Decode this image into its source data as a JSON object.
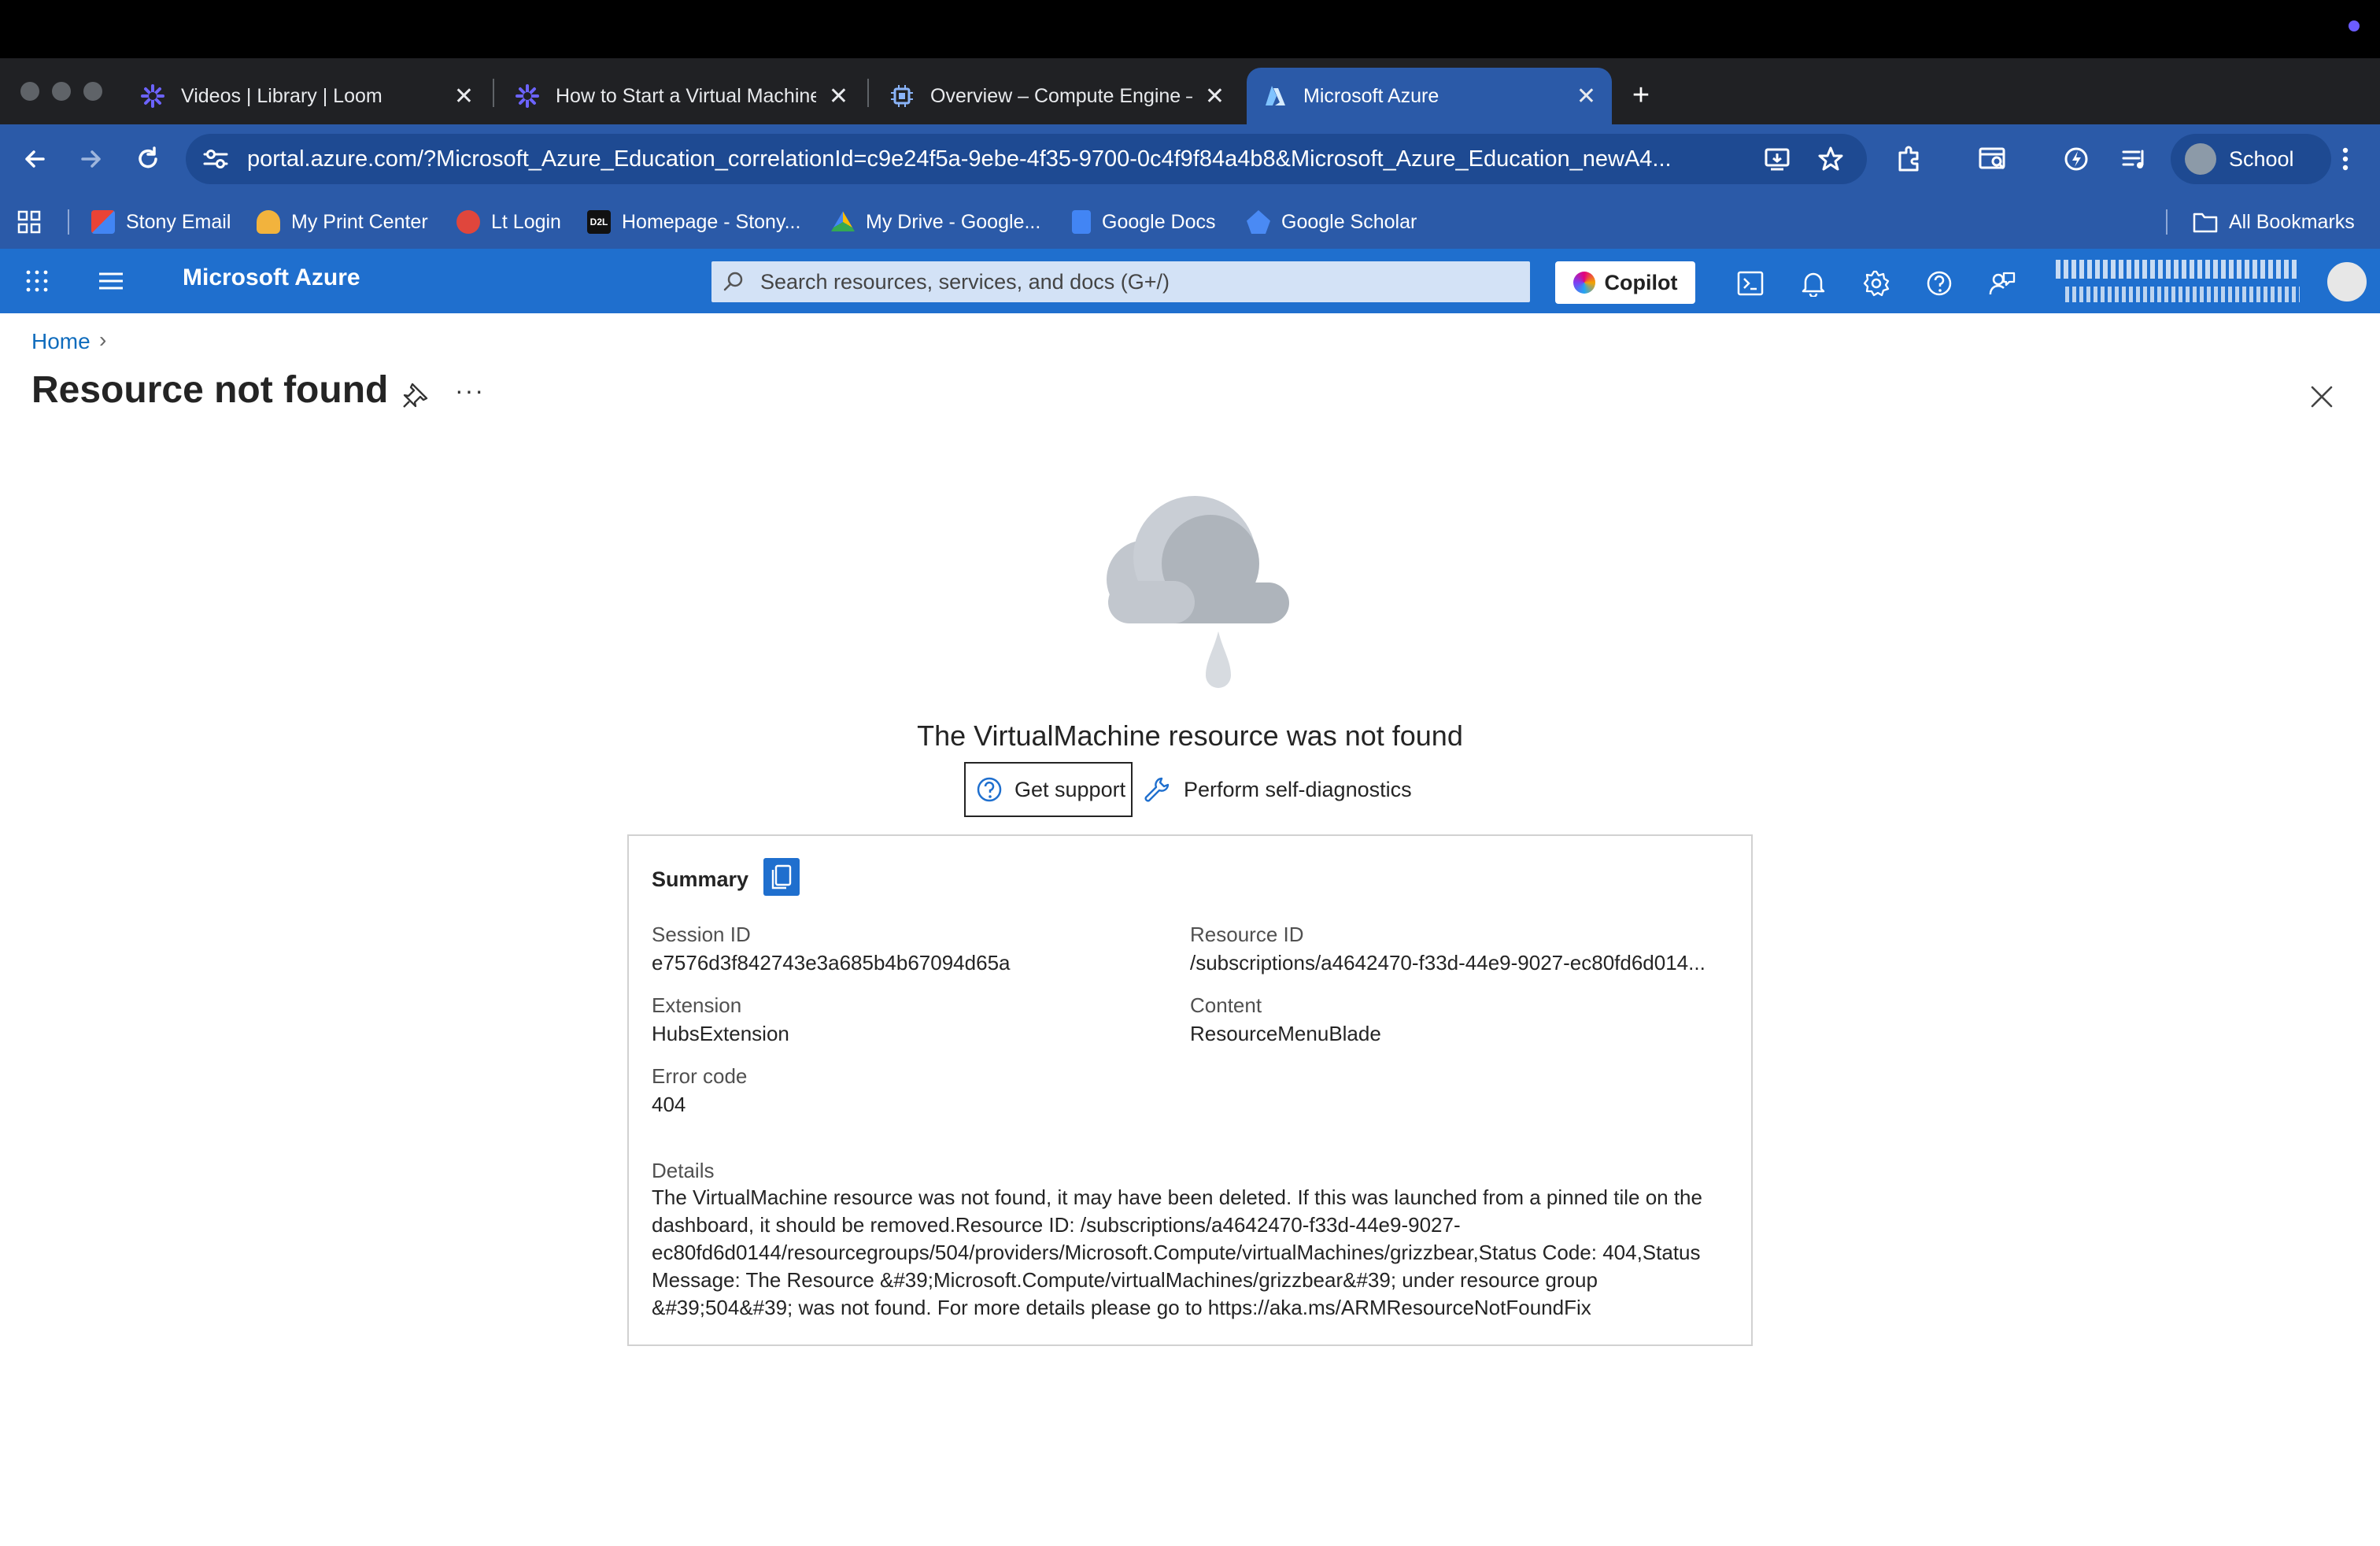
{
  "browser": {
    "tabs": [
      {
        "title": "Videos | Library | Loom",
        "icon": "loom-icon"
      },
      {
        "title": "How to Start a Virtual Machine",
        "icon": "loom-icon"
      },
      {
        "title": "Overview – Compute Engine –",
        "icon": "compute-engine-icon"
      },
      {
        "title": "Microsoft Azure",
        "icon": "azure-icon",
        "active": true
      }
    ],
    "url": "portal.azure.com/?Microsoft_Azure_Education_correlationId=c9e24f5a-9ebe-4f35-9700-0c4f9f84a4b8&Microsoft_Azure_Education_newA4...",
    "profile_label": "School",
    "bookmarks": [
      {
        "label": "Stony Email",
        "icon": "gmail-icon",
        "color": "#ea4335"
      },
      {
        "label": "My Print Center",
        "icon": "hand-icon",
        "color": "#f2b33d"
      },
      {
        "label": "Lt Login",
        "icon": "lt-icon",
        "color": "#e0463c"
      },
      {
        "label": "Homepage - Stony...",
        "icon": "d2l-icon",
        "color": "#111111"
      },
      {
        "label": "My Drive - Google...",
        "icon": "google-drive-icon",
        "color": "#34a853"
      },
      {
        "label": "Google Docs",
        "icon": "google-docs-icon",
        "color": "#4285f4"
      },
      {
        "label": "Google Scholar",
        "icon": "google-scholar-icon",
        "color": "#4a8af4"
      }
    ],
    "all_bookmarks": "All Bookmarks"
  },
  "azure": {
    "brand": "Microsoft Azure",
    "search_placeholder": "Search resources, services, and docs (G+/)",
    "copilot_label": "Copilot"
  },
  "breadcrumb": {
    "home": "Home",
    "separator": "›"
  },
  "page": {
    "title": "Resource not found",
    "more": "···",
    "message": "The VirtualMachine resource was not found",
    "get_support": "Get support",
    "self_diagnostics": "Perform self-diagnostics"
  },
  "summary": {
    "title": "Summary",
    "session_id_label": "Session ID",
    "session_id": "e7576d3f842743e3a685b4b67094d65a",
    "resource_id_label": "Resource ID",
    "resource_id": "/subscriptions/a4642470-f33d-44e9-9027-ec80fd6d014...",
    "extension_label": "Extension",
    "extension": "HubsExtension",
    "content_label": "Content",
    "content": "ResourceMenuBlade",
    "error_code_label": "Error code",
    "error_code": "404",
    "details_label": "Details",
    "details": "The VirtualMachine resource was not found, it may have been deleted. If this was launched from a pinned tile on the dashboard, it should be removed.Resource ID: /subscriptions/a4642470-f33d-44e9-9027-ec80fd6d0144/resourcegroups/504/providers/Microsoft.Compute/virtualMachines/grizzbear,Status Code: 404,Status Message: The Resource &#39;Microsoft.Compute/virtualMachines/grizzbear&#39; under resource group &#39;504&#39; was not found. For more details please go to https://aka.ms/ARMResourceNotFoundFix"
  },
  "colors": {
    "azure_header": "#1f6fce",
    "browser_chrome": "#2b5aa8",
    "link": "#0f6cbd"
  }
}
